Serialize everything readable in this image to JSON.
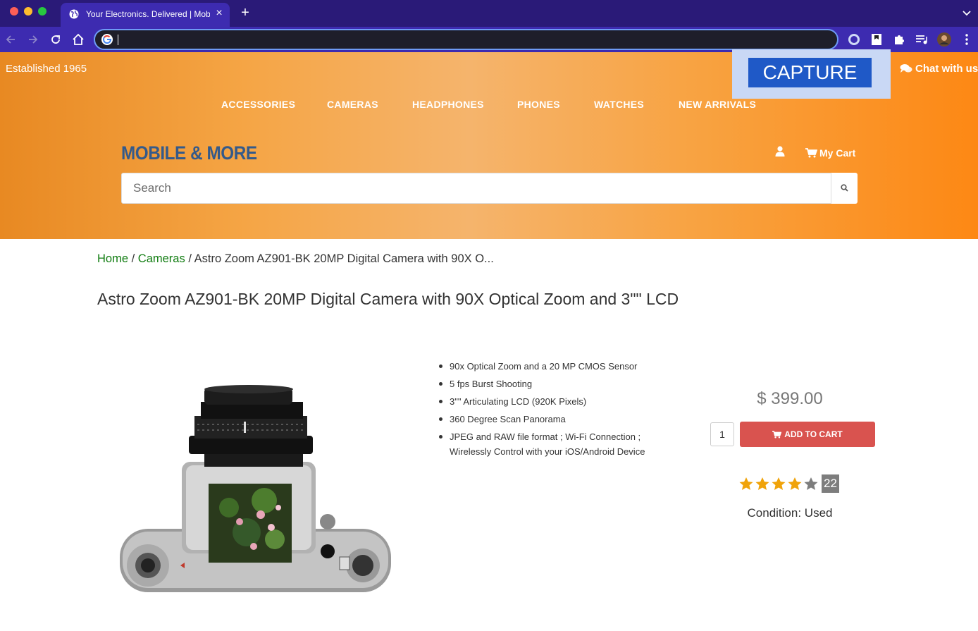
{
  "browser": {
    "tab_title": "Your Electronics. Delivered | Mobile & More",
    "address_value": ""
  },
  "header": {
    "established": "Established 1965",
    "capture_label": "CAPTURE",
    "chat_label": "Chat with us",
    "nav": [
      "ACCESSORIES",
      "CAMERAS",
      "HEADPHONES",
      "PHONES",
      "WATCHES",
      "NEW ARRIVALS"
    ],
    "logo": "MOBILE & MORE",
    "cart_label": "My Cart",
    "search_placeholder": "Search"
  },
  "breadcrumb": {
    "home": "Home",
    "sep1": "/",
    "category": "Cameras",
    "sep2": "/",
    "current": "Astro Zoom AZ901-BK 20MP Digital Camera with 90X O..."
  },
  "product": {
    "title": "Astro Zoom AZ901-BK 20MP Digital Camera with 90X Optical Zoom and 3\"\" LCD",
    "features": [
      "90x Optical Zoom and a 20 MP CMOS Sensor",
      "5 fps Burst Shooting",
      "3\"\" Articulating LCD (920K Pixels)",
      "360 Degree Scan Panorama",
      "JPEG and RAW file format ; Wi-Fi Connection ; Wirelessly Control with your iOS/Android Device"
    ],
    "price": "$ 399.00",
    "quantity": "1",
    "add_to_cart_label": "ADD TO CART",
    "rating": 4,
    "rating_max": 5,
    "review_count": "22",
    "condition": "Condition: Used"
  },
  "colors": {
    "header_orange": "#f8a240",
    "add_to_cart": "#d9534f",
    "breadcrumb_link": "#107c10",
    "logo_blue": "#345a8a",
    "star_filled": "#f0a30a",
    "star_empty": "#7d7d7d"
  },
  "icons": {
    "tab": "globe-icon",
    "chat": "comments-icon",
    "user": "user-icon",
    "cart": "cart-icon",
    "search": "search-icon"
  }
}
